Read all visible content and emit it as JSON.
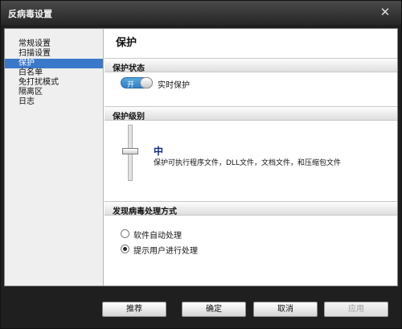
{
  "window": {
    "title": "反病毒设置"
  },
  "sidebar": {
    "items": [
      {
        "label": "常规设置"
      },
      {
        "label": "扫描设置"
      },
      {
        "label": "保护",
        "active": true
      },
      {
        "label": "白名单"
      },
      {
        "label": "免打扰模式"
      },
      {
        "label": "隔离区"
      },
      {
        "label": "日志"
      }
    ]
  },
  "main": {
    "title": "保护",
    "protection_status": {
      "heading": "保护状态",
      "toggle_on_label": "开",
      "toggle_state": "on",
      "realtime_label": "实时保护"
    },
    "protection_level": {
      "heading": "保护级别",
      "level": "中",
      "description": "保护可执行程序文件，DLL文件，文档文件，和压缩包文件"
    },
    "virus_handling": {
      "heading": "发现病毒处理方式",
      "options": [
        {
          "label": "软件自动处理",
          "checked": false
        },
        {
          "label": "提示用户进行处理",
          "checked": true
        }
      ]
    }
  },
  "footer": {
    "buttons": [
      {
        "label": "推荐",
        "enabled": true
      },
      {
        "label": "确定",
        "enabled": true
      },
      {
        "label": "取消",
        "enabled": true
      },
      {
        "label": "应用",
        "enabled": false
      }
    ]
  },
  "colors": {
    "accent": "#3a79c9",
    "toggle_on": "#2e7ec4",
    "level_text": "#0b2a8c",
    "chrome": "#1f1f1f"
  },
  "icons": {
    "close": "close-icon"
  }
}
